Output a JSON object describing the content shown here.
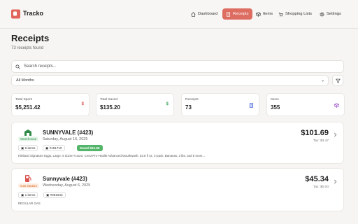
{
  "app": {
    "name": "Tracko"
  },
  "nav": [
    {
      "label": "Dashboard",
      "icon": "home-icon"
    },
    {
      "label": "Receipts",
      "icon": "receipt-icon"
    },
    {
      "label": "Items",
      "icon": "box-icon"
    },
    {
      "label": "Shopping Lists",
      "icon": "cart-icon"
    },
    {
      "label": "Settings",
      "icon": "gear-icon"
    }
  ],
  "header": {
    "title": "Receipts",
    "subtitle": "73 receipts found"
  },
  "search": {
    "placeholder": "Search receipts..."
  },
  "filter": {
    "period": "All Months"
  },
  "stats": [
    {
      "label": "Total Spent",
      "value": "$5,251.42",
      "icon": "$",
      "color": "#d9534f"
    },
    {
      "label": "Total Saved",
      "value": "$135.20",
      "icon": "$",
      "color": "#3fa45b"
    },
    {
      "label": "Receipts",
      "value": "73",
      "icon": "receipt-icon",
      "color": "#3b5bdb"
    },
    {
      "label": "Items",
      "value": "355",
      "icon": "box-icon",
      "color": "#9b4dca"
    }
  ],
  "receipts": [
    {
      "store": "SUNNYVALE (#423)",
      "date": "Saturday, August 16, 2025",
      "category": "Warehouse",
      "category_color": "#3fa45b",
      "items": "6 items",
      "number": "#151719",
      "saved": "Saved $11.50",
      "description": "Kirkland Signature Eggs, Large, 5 dozen+count, Crest Pro-Health Advanced Mouthwash, 33.8 fl oz, 2-pack, Bananas, 3 lbs, and 5 more...",
      "total": "$101.69",
      "tax": "Tax: $3.47"
    },
    {
      "store": "Sunnyvale (#423)",
      "date": "Wednesday, August 6, 2025",
      "category": "Gas Station",
      "category_color": "#e07a2e",
      "items": "1 items",
      "number": "#051943",
      "description": "REGULAR GAS",
      "total": "$45.34",
      "tax": "Tax: $0.00"
    }
  ]
}
